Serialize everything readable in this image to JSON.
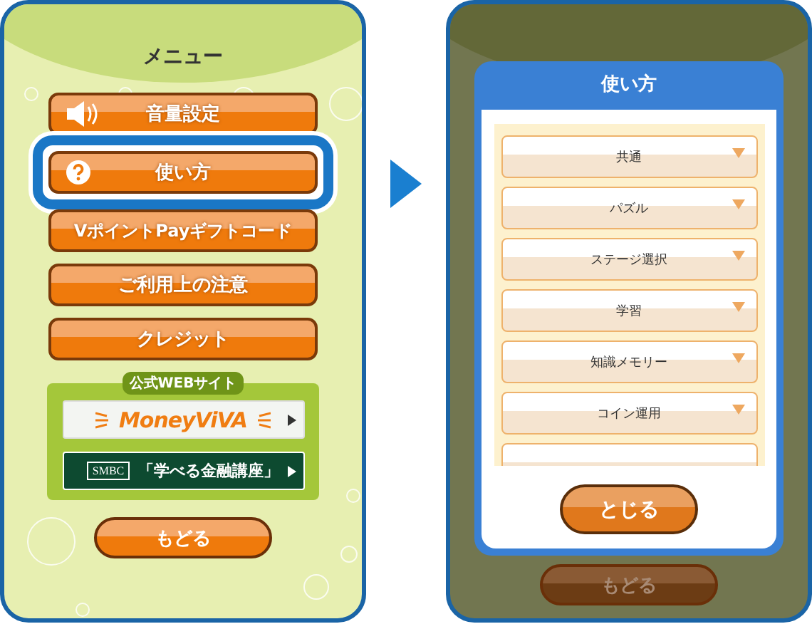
{
  "menu_screen": {
    "title": "メニュー",
    "menu_buttons": [
      {
        "label": "音量設定",
        "kind": "sound",
        "selected": false
      },
      {
        "label": "使い方",
        "kind": "help",
        "selected": true
      },
      {
        "label": "VポイントPayギフトコード",
        "kind": "plain",
        "selected": false
      },
      {
        "label": "ご利用上の注意",
        "kind": "plain",
        "selected": false
      },
      {
        "label": "クレジット",
        "kind": "plain",
        "selected": false
      }
    ],
    "official_site": {
      "label": "公式WEBサイト",
      "links": [
        {
          "kind": "moneyviva",
          "label": "MoneyViVA"
        },
        {
          "kind": "smbc",
          "badge": "SMBC",
          "label": "「学べる金融講座」"
        }
      ]
    },
    "back_button": "もどる"
  },
  "help_screen": {
    "modal": {
      "title": "使い方",
      "sections": [
        {
          "label": "共通",
          "expanded": false
        },
        {
          "label": "パズル",
          "expanded": false
        },
        {
          "label": "ステージ選択",
          "expanded": false
        },
        {
          "label": "学習",
          "expanded": false
        },
        {
          "label": "知識メモリー",
          "expanded": false
        },
        {
          "label": "コイン運用",
          "expanded": false
        }
      ],
      "close_button": "とじる"
    },
    "back_button": "もどる"
  }
}
